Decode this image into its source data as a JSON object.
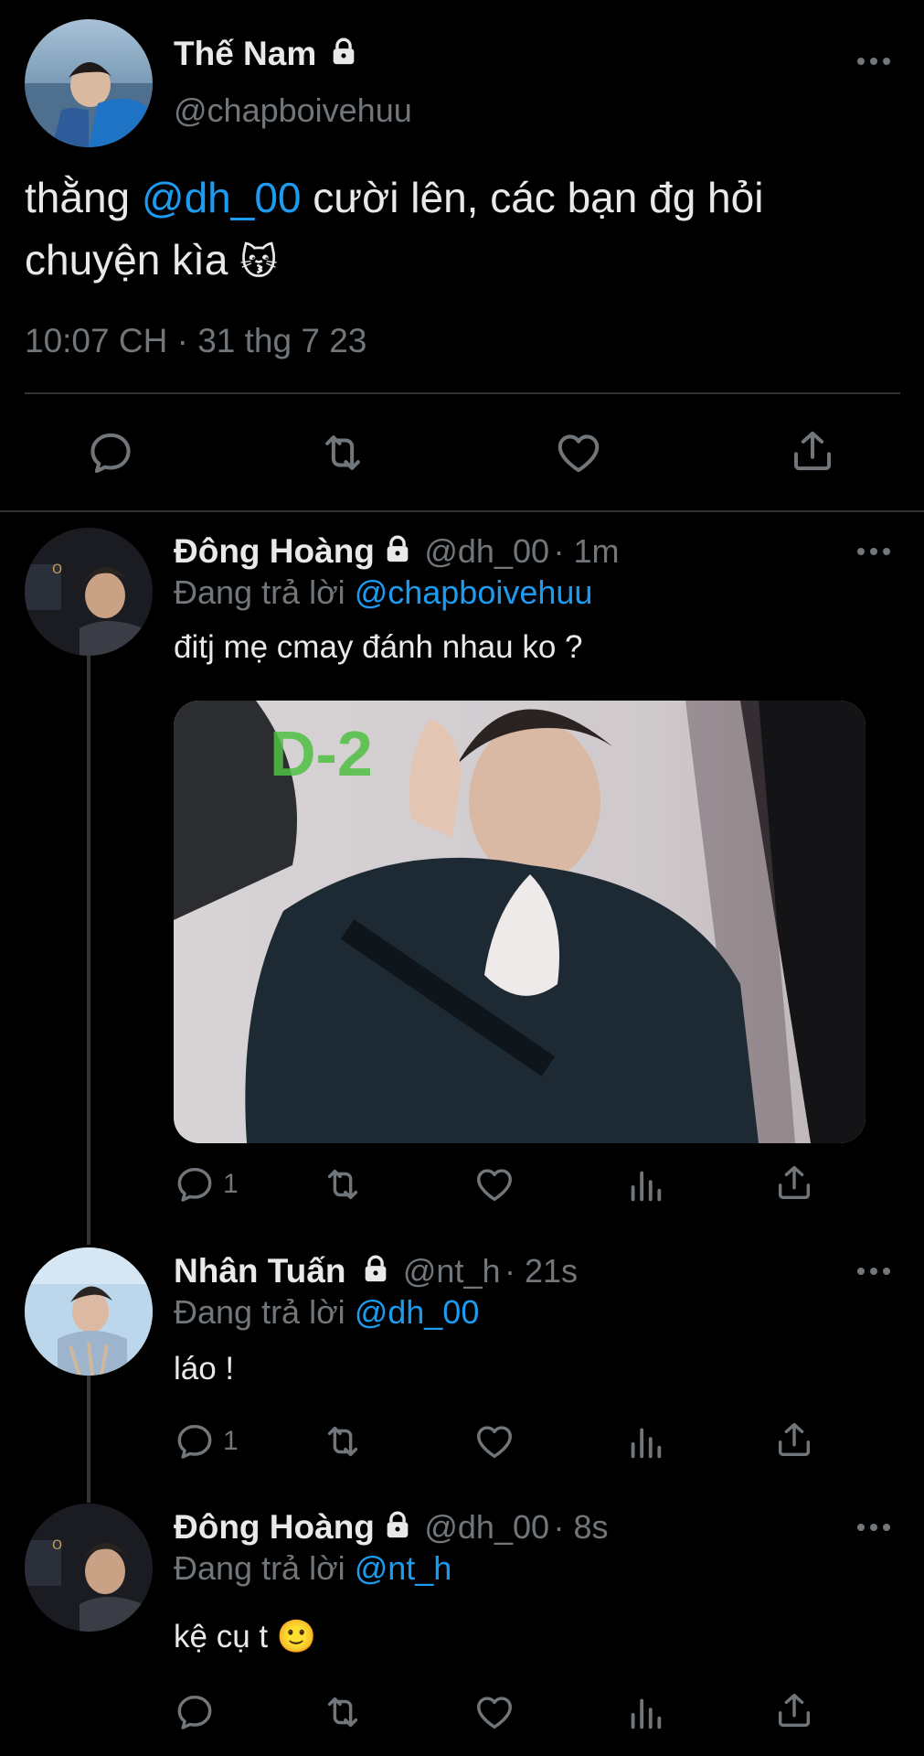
{
  "main_tweet": {
    "author_name": "Thế Nam",
    "author_handle": "@chapboivehuu",
    "text_before": "thằng ",
    "mention": "@dh_00",
    "text_after": " cười lên, các bạn đg hỏi chuyện kìa",
    "emoji": "😽",
    "timestamp": "10:07 CH · 31 thg 7 23"
  },
  "replies": [
    {
      "author_name": "Đông Hoàng",
      "author_handle": "@dh_00",
      "time": "· 1m",
      "replying_prefix": "Đang trả lời ",
      "replying_to": "@chapboivehuu",
      "text": "đitj mẹ cmay đánh nhau ko ?",
      "reply_count": "1",
      "media_overlay_text": "D-2"
    },
    {
      "author_name": "Nhân Tuấn",
      "author_handle": "@nt_h",
      "time": "· 21s",
      "replying_prefix": "Đang trả lời ",
      "replying_to": "@dh_00",
      "text": "láo !",
      "reply_count": "1"
    },
    {
      "author_name": "Đông Hoàng",
      "author_handle": "@dh_00",
      "time": "· 8s",
      "replying_prefix": "Đang trả lời ",
      "replying_to": "@nt_h",
      "text": "kệ cụ t",
      "emoji": "🙂"
    }
  ],
  "icons": {
    "more": "more-horizontal-icon",
    "lock": "lock-icon",
    "reply": "reply-icon",
    "retweet": "retweet-icon",
    "like": "heart-icon",
    "views": "views-icon",
    "share": "share-icon"
  },
  "colors": {
    "background": "#000000",
    "text": "#e7e9ea",
    "muted": "#71767b",
    "link": "#1d9bf0",
    "divider": "#2f3336"
  }
}
